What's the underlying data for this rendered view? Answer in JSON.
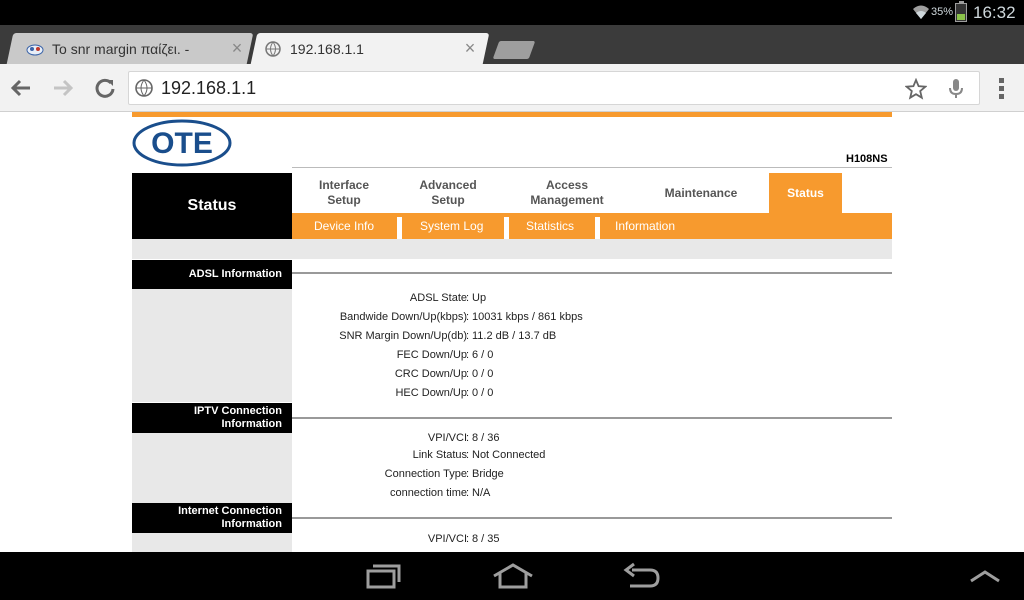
{
  "system": {
    "battery_pct": "35%",
    "battery_level": 0.35,
    "time": "16:32"
  },
  "browser": {
    "tabs": [
      {
        "title": "Το snr margin παίζει. -",
        "active": false
      },
      {
        "title": "192.168.1.1",
        "active": true
      }
    ],
    "url": "192.168.1.1"
  },
  "router": {
    "logo_text": "OTE",
    "model": "H108NS",
    "status_block": "Status",
    "main_nav": [
      "Interface\nSetup",
      "Advanced\nSetup",
      "Access\nManagement",
      "Maintenance",
      "Status"
    ],
    "sub_nav": [
      "Device Info",
      "System Log",
      "Statistics",
      "Information"
    ],
    "sections": [
      {
        "title": "ADSL Information",
        "rows": [
          {
            "label": "ADSL State",
            "value": "Up"
          },
          {
            "label": "Bandwide Down/Up(kbps)",
            "value": "10031 kbps / 861 kbps"
          },
          {
            "label": "SNR Margin Down/Up(db)",
            "value": "11.2 dB / 13.7 dB"
          },
          {
            "label": "FEC Down/Up",
            "value": "6 / 0"
          },
          {
            "label": "CRC Down/Up",
            "value": "0 / 0"
          },
          {
            "label": "HEC Down/Up",
            "value": "0 / 0"
          }
        ]
      },
      {
        "title": "IPTV Connection Information",
        "rows": [
          {
            "label": "VPI/VCI",
            "value": "8 / 36"
          },
          {
            "label": "Link Status",
            "value": "Not Connected"
          },
          {
            "label": "Connection Type",
            "value": "Bridge"
          },
          {
            "label": "connection time",
            "value": "N/A"
          }
        ]
      },
      {
        "title": "Internet Connection Information",
        "rows": [
          {
            "label": "VPI/VCI",
            "value": "8 / 35"
          }
        ]
      }
    ]
  },
  "colors": {
    "accent": "#f79a2e",
    "logo_blue": "#1a4e8c",
    "battery_green": "#8bc34a"
  }
}
